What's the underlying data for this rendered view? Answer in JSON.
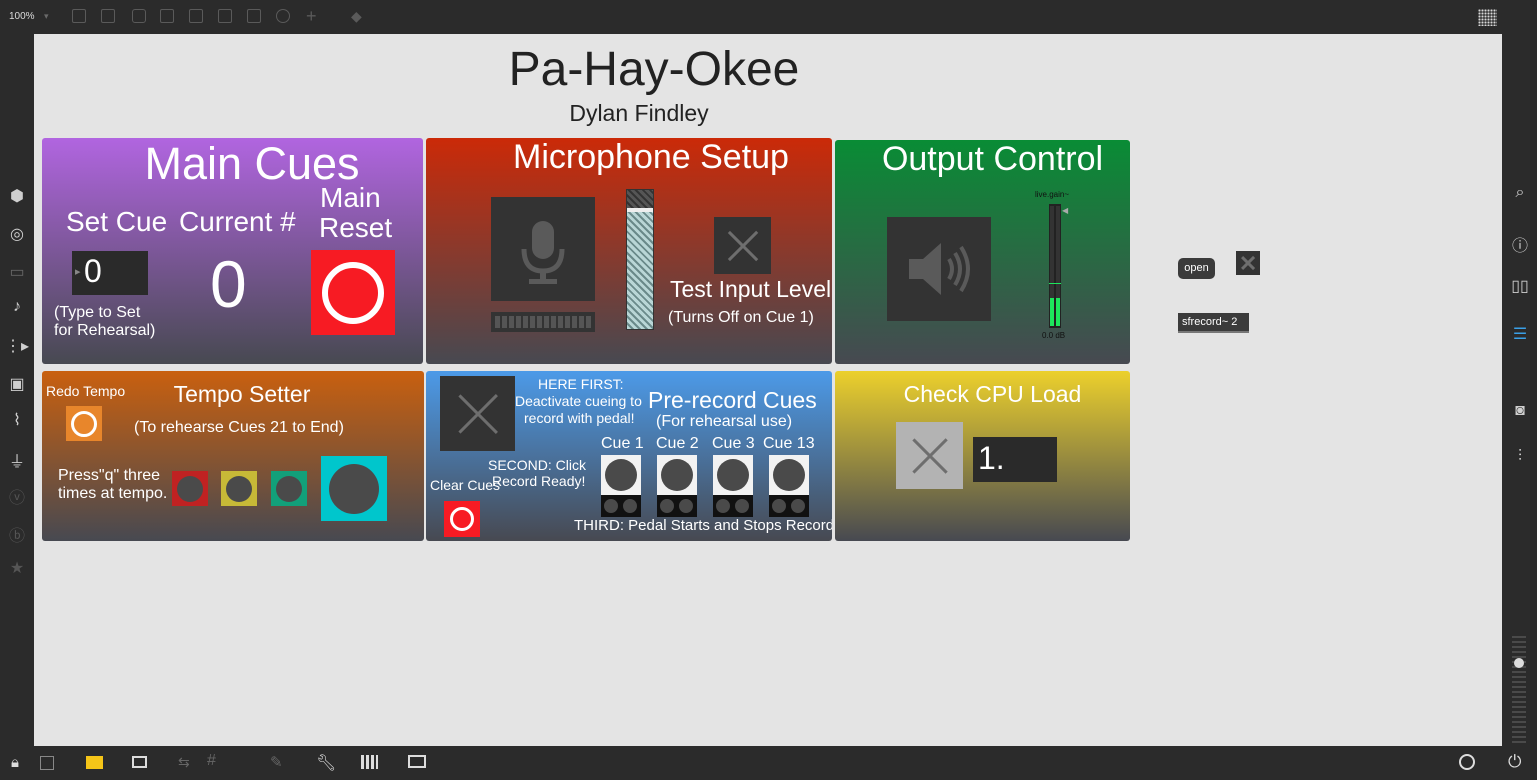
{
  "toolbar": {
    "zoom": "100%"
  },
  "patch": {
    "title": "Pa-Hay-Okee",
    "author": "Dylan Findley"
  },
  "main_cues": {
    "title": "Main Cues",
    "set_cue_label": "Set Cue",
    "current_label": "Current #",
    "reset_label_1": "Main",
    "reset_label_2": "Reset",
    "set_cue_value": "0",
    "current_value": "0",
    "hint_1": "(Type to Set",
    "hint_2": "for Rehearsal)"
  },
  "microphone": {
    "title": "Microphone Setup",
    "test_label": "Test Input Level",
    "test_hint": "(Turns Off on Cue 1)"
  },
  "output": {
    "title": "Output Control",
    "gain_label": "live.gain~",
    "gain_value": "0.0 dB"
  },
  "externals": {
    "open_label": "open",
    "sfrecord_label": "sfrecord~ 2"
  },
  "tempo": {
    "title": "Tempo Setter",
    "redo_label": "Redo Tempo",
    "subtitle": "(To rehearse Cues 21 to End)",
    "hint_1": "Press\"q\" three",
    "hint_2": "times at tempo."
  },
  "prerecord": {
    "title": "Pre-record Cues",
    "subtitle": "(For rehearsal use)",
    "first_1": "HERE FIRST:",
    "first_2": "Deactivate cueing to",
    "first_3": "record with pedal!",
    "second_1": "SECOND: Click",
    "second_2": "Record Ready!",
    "clear_label": "Clear Cues",
    "third": "THIRD: Pedal Starts and Stops Recording.",
    "cues": [
      "Cue 1",
      "Cue 2",
      "Cue 3",
      "Cue 13"
    ]
  },
  "cpu": {
    "title": "Check CPU Load",
    "value": "1."
  },
  "colors": {
    "main_cues_grad": [
      "#b165e0",
      "#474951"
    ],
    "mic_grad": [
      "#cb2a08",
      "#474951"
    ],
    "output_grad": [
      "#098c35",
      "#474951"
    ],
    "tempo_grad": [
      "#c9600f",
      "#474951"
    ],
    "prerecord_grad": [
      "#4c9ae8",
      "#474951"
    ],
    "cpu_grad": [
      "#ecd02c",
      "#474951"
    ],
    "reset_button": "#f71b23",
    "meter_green": "#1de65c"
  }
}
